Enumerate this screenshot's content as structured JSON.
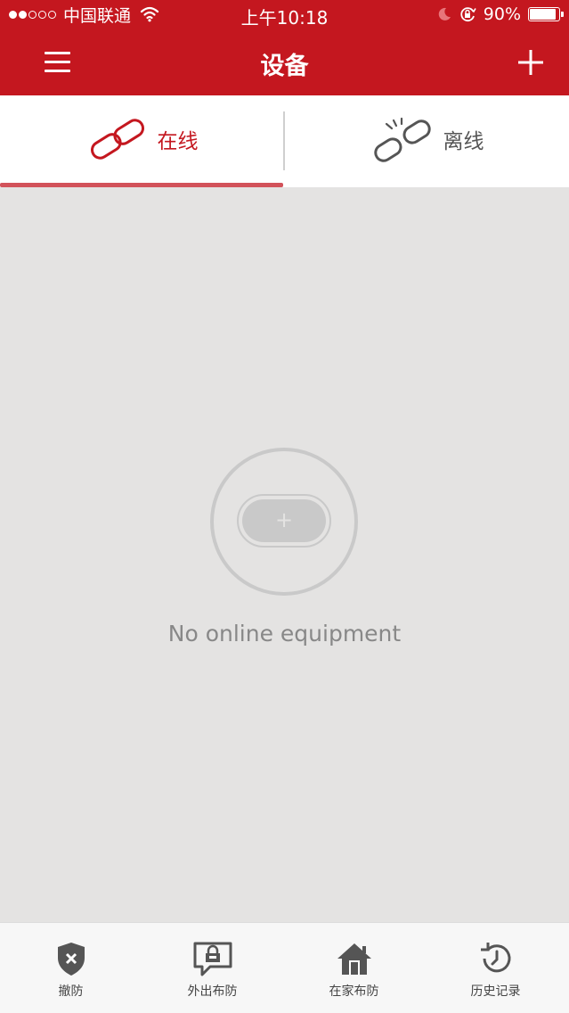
{
  "status_bar": {
    "carrier": "中国联通",
    "time": "上午10:18",
    "battery": "90%",
    "battery_level": 0.9
  },
  "nav": {
    "title": "设备"
  },
  "tabs": [
    {
      "label": "在线",
      "icon": "link-icon",
      "active": true
    },
    {
      "label": "离线",
      "icon": "broken-link-icon",
      "active": false
    }
  ],
  "empty_state": {
    "message": "No online equipment"
  },
  "bottom_bar": [
    {
      "label": "撤防",
      "icon": "shield-x-icon"
    },
    {
      "label": "外出布防",
      "icon": "away-arm-icon"
    },
    {
      "label": "在家布防",
      "icon": "home-arm-icon"
    },
    {
      "label": "历史记录",
      "icon": "history-icon"
    }
  ],
  "colors": {
    "brand": "#c4171f",
    "background": "#e4e3e2",
    "tab_indicator": "#d2525a",
    "muted": "#888888"
  }
}
